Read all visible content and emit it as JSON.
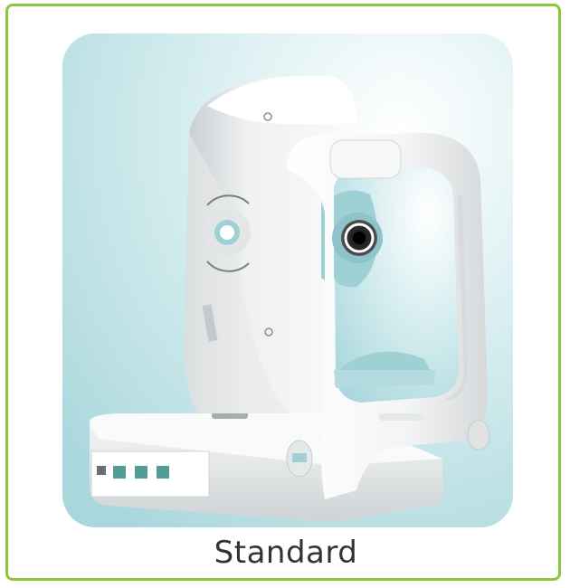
{
  "product": {
    "caption": "Standard",
    "image_icon": "fundus-camera-device-icon"
  },
  "colors": {
    "card_border": "#8cc63f",
    "caption_text": "#333333",
    "background_teal": "#b7dfe3",
    "device_white": "#f1f2f3",
    "accent_teal": "#9fd0d4"
  }
}
